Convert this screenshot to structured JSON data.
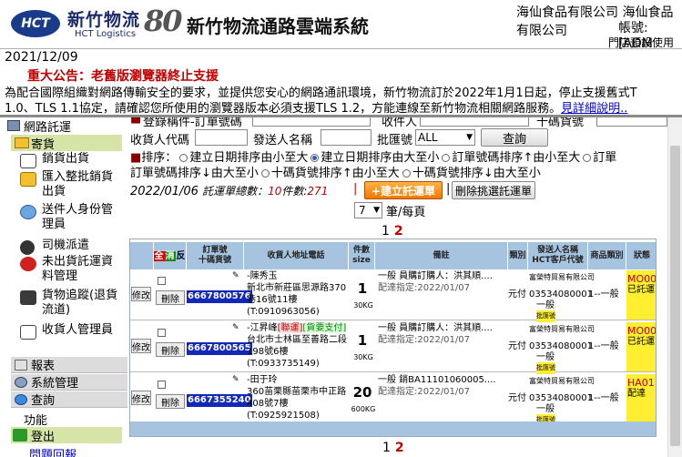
{
  "header": {
    "logo_text": "HCT",
    "brand_cn": "新竹物流",
    "brand_en": "HCT Logistics",
    "anniversary": "80",
    "system_title": "新竹物流通路雲端系統",
    "company": "海仙食品有限公司 海仙食品有限公司",
    "account": "帳號:[ADM",
    "tip": "門店預設使用"
  },
  "notice": {
    "date": "2021/12/09",
    "title": "重大公告：老舊版瀏覽器終止支援",
    "line1": "為配合國際組織對網路傳輸安全的要求，並提供您安心的網路通訊環境，新竹物流訂於2022年1月1日起，停止支援舊式T",
    "line2": "1.0、TLS 1.1協定，請確認您所使用的瀏覽器版本必須支援TLS 1.2，方能連線至新竹物流相關網路服務。",
    "link": "見詳細說明.."
  },
  "sidebar": {
    "online_order": "網路託運",
    "shipping": "寄貨",
    "items": [
      {
        "label": "銷貨出貨"
      },
      {
        "label": "匯入整批銷貨出貨"
      },
      {
        "label": "送件人身份管理員"
      },
      {
        "label": "司機派遣"
      },
      {
        "label": "未出貨託運資料管理"
      },
      {
        "label": "貨物追蹤(退貨流道)"
      },
      {
        "label": "收貨人管理員"
      }
    ],
    "sections": [
      {
        "label": "報表"
      },
      {
        "label": "系統管理"
      },
      {
        "label": "查詢"
      }
    ],
    "function_label": "功能",
    "logout": "登出",
    "feedback": "問題回報"
  },
  "filters": {
    "row0_label1": "登錄稱件-訂單號碼",
    "row0_label2": "收件人",
    "row0_label3": "十碼貨號",
    "receiver_code_label": "收貨人代碼",
    "sender_name_label": "發送人名稱",
    "batch_label": "批匯號",
    "batch_value": "ALL",
    "query_button": "查詢",
    "sort_label": "排序：",
    "sort_options": [
      "建立日期排序由小至大",
      "建立日期排序由大至小",
      "訂單號碼排序↑由小至大",
      "訂單號碼排序↓由大至小",
      "十碼貨號排序↑由小至大",
      "十碼貨號排序↓由大至小"
    ]
  },
  "summary": {
    "date": "2022/01/06",
    "label_total": "託運單總數：",
    "total": "10",
    "label_count": "件數:",
    "count": "271",
    "new_button": "+建立託運單",
    "delete_button": "刪除挑選託運單",
    "page_size": "7",
    "page_size_suffix": "筆/每頁"
  },
  "pager": {
    "page1": "1",
    "page2": "2"
  },
  "table": {
    "headers": {
      "select_all": "全",
      "clear": "消",
      "reverse": "反",
      "order_no": "訂單號\n十碼貨號",
      "recipient": "收貨人地址電話",
      "pieces": "件數\nsize",
      "remark": "備註",
      "category": "類別",
      "sender": "發送人名稱\nHCT客戶代號",
      "product_type": "商品類別",
      "status": "狀態"
    },
    "edit_label": "修改",
    "delete_label": "刪除",
    "rows": [
      {
        "order_no": "6667800576",
        "recipient_name": "-陳秀玉",
        "address": "新北市新莊區思源路370",
        "address2": "巷16號11樓",
        "phone": "(T:0910963056)",
        "tag": "",
        "tag2": "",
        "pieces": "1",
        "size": "30KG",
        "remark": "一般 員購訂購人：洪其順....",
        "delivery": "配達指定:2022/01/07",
        "category": "元付",
        "sender_name": "富榮特貿易有限公司",
        "sender_code": "03534080001",
        "sender_tier": "一般",
        "product_type": "1--一般",
        "status_code": "MO00",
        "status_text": "已託運"
      },
      {
        "order_no": "6667800565",
        "recipient_name": "-江昇峰",
        "address": "台北市士林區至善路二段",
        "address2": "198號6樓",
        "phone": "(T:0933735149)",
        "tag": "[聯運]",
        "tag2": "[貨要支付]",
        "pieces": "1",
        "size": "30KG",
        "remark": "一般 員購訂購人：洪其順....",
        "delivery": "配達指定:2022/01/07",
        "category": "元付",
        "sender_name": "富榮特貿易有限公司",
        "sender_code": "03534080001",
        "sender_tier": "一般",
        "product_type": "1--一般",
        "status_code": "MO00",
        "status_text": "已託運"
      },
      {
        "order_no": "6667355240",
        "recipient_name": "-田于玲",
        "address": "360苗栗縣苗栗市中正路",
        "address2": "408號7樓",
        "phone": "(T:0925921508)",
        "tag": "",
        "tag2": "",
        "pieces": "20",
        "size": "600KG",
        "remark": "一般 銷BA11101060005....",
        "delivery": "配達指定:2022/01/07",
        "category": "元付",
        "sender_name": "富榮特貿易有限公司",
        "sender_code": "03534080001",
        "sender_tier": "一般",
        "product_type": "1--一般",
        "status_code": "HA01",
        "status_text": "配達"
      }
    ],
    "batch_tag": "批匯號"
  },
  "colors": {
    "header_blue": "#1a3a8a",
    "accent_red": "#c00000",
    "order_blue": "#1428b8",
    "status_yellow": "#ffef30",
    "sidebar_green": "#d6e4a8"
  }
}
